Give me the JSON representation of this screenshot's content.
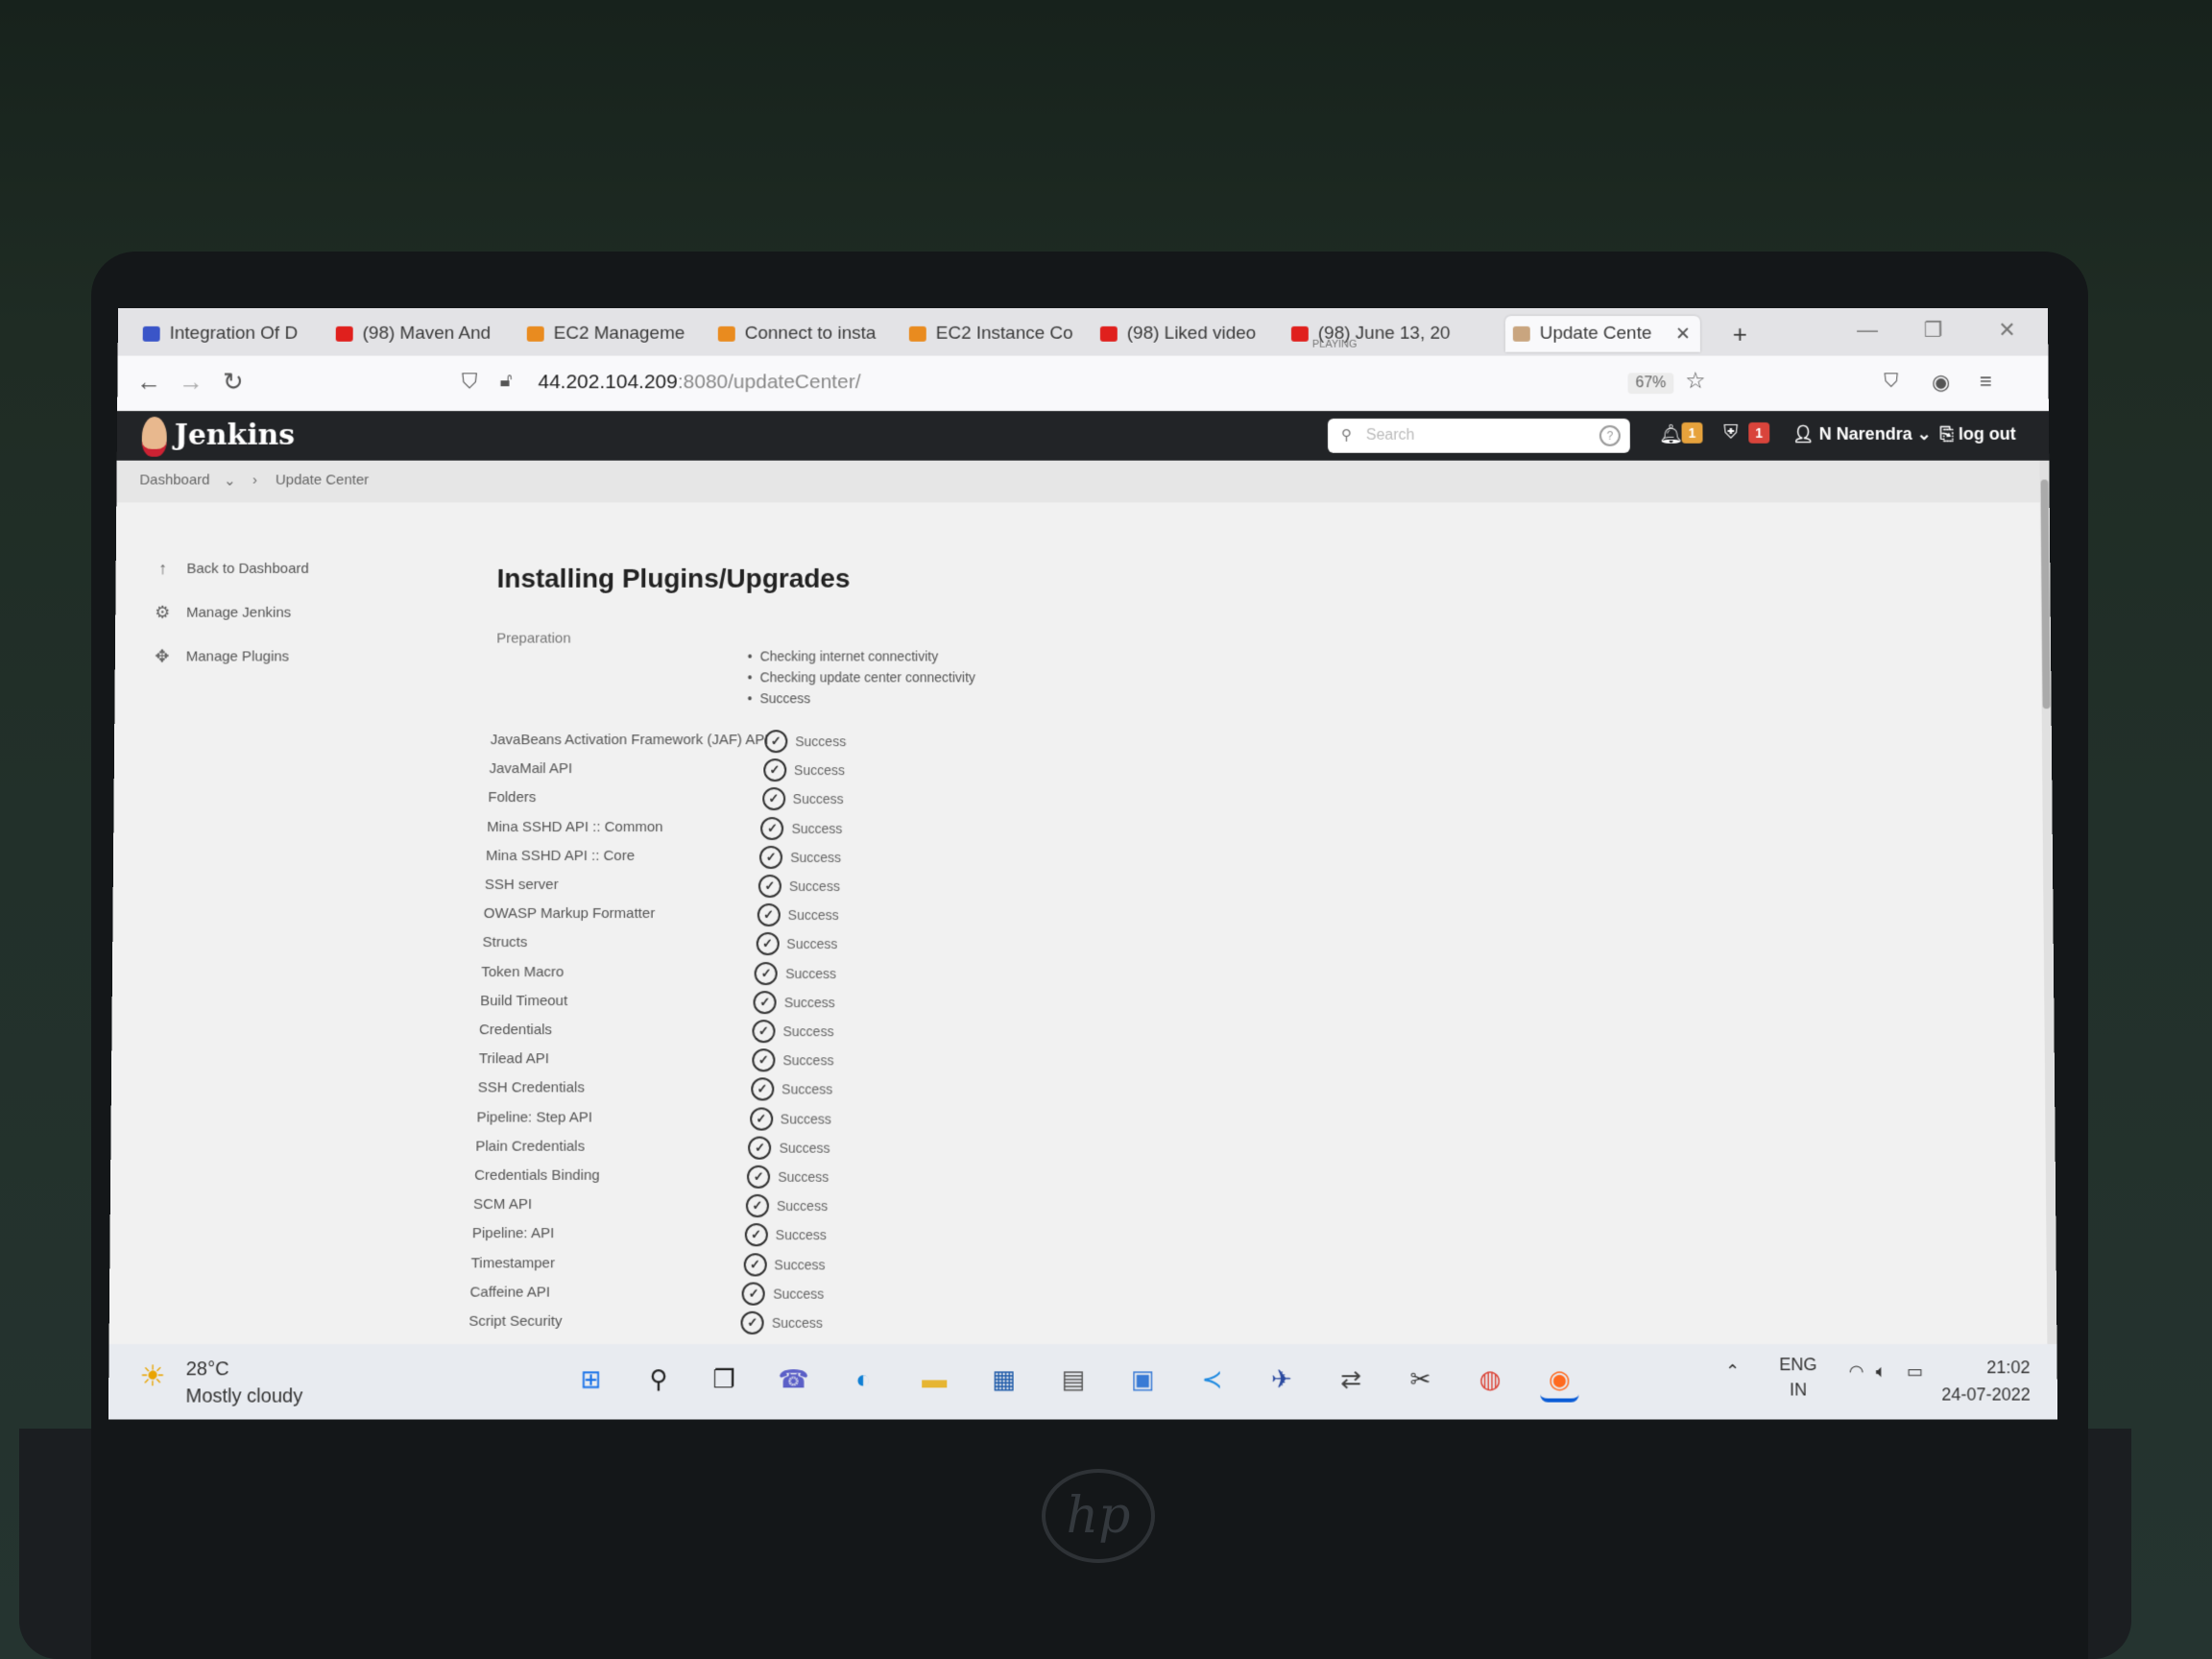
{
  "browser": {
    "tabs": [
      {
        "label": "Integration Of D",
        "icon": "codecademy-icon",
        "color": "#3a55c8"
      },
      {
        "label": "(98) Maven And",
        "icon": "youtube-icon",
        "color": "#e0201d"
      },
      {
        "label": "EC2 Manageme",
        "icon": "aws-icon",
        "color": "#e98b1f"
      },
      {
        "label": "Connect to insta",
        "icon": "aws-icon",
        "color": "#e98b1f"
      },
      {
        "label": "EC2 Instance Co",
        "icon": "aws-icon",
        "color": "#e98b1f"
      },
      {
        "label": "(98) Liked video",
        "icon": "youtube-icon",
        "color": "#e0201d"
      },
      {
        "label": "(98) June 13, 20",
        "sub": "PLAYING",
        "icon": "youtube-icon",
        "color": "#e0201d"
      },
      {
        "label": "Update Cente",
        "icon": "jenkins-icon",
        "color": "#c9a57f"
      }
    ],
    "url_host": "44.202.104.209",
    "url_rest": ":8080/updateCenter/",
    "zoom": "67%"
  },
  "jenkins": {
    "logo": "Jenkins",
    "search_placeholder": "Search",
    "notifications_count": "1",
    "security_count": "1",
    "user": "N Narendra",
    "logout": "log out",
    "breadcrumb": [
      "Dashboard",
      "Update Center"
    ],
    "side": [
      {
        "label": "Back to Dashboard",
        "icon": "arrow-up-icon"
      },
      {
        "label": "Manage Jenkins",
        "icon": "gear-icon"
      },
      {
        "label": "Manage Plugins",
        "icon": "puzzle-icon"
      }
    ],
    "title": "Installing Plugins/Upgrades",
    "preparation": {
      "label": "Preparation",
      "items": [
        "Checking internet connectivity",
        "Checking update center connectivity",
        "Success"
      ]
    },
    "plugins": [
      {
        "name": "JavaBeans Activation Framework (JAF) API",
        "status": "Success"
      },
      {
        "name": "JavaMail API",
        "status": "Success"
      },
      {
        "name": "Folders",
        "status": "Success"
      },
      {
        "name": "Mina SSHD API :: Common",
        "status": "Success"
      },
      {
        "name": "Mina SSHD API :: Core",
        "status": "Success"
      },
      {
        "name": "SSH server",
        "status": "Success"
      },
      {
        "name": "OWASP Markup Formatter",
        "status": "Success"
      },
      {
        "name": "Structs",
        "status": "Success"
      },
      {
        "name": "Token Macro",
        "status": "Success"
      },
      {
        "name": "Build Timeout",
        "status": "Success"
      },
      {
        "name": "Credentials",
        "status": "Success"
      },
      {
        "name": "Trilead API",
        "status": "Success"
      },
      {
        "name": "SSH Credentials",
        "status": "Success"
      },
      {
        "name": "Pipeline: Step API",
        "status": "Success"
      },
      {
        "name": "Plain Credentials",
        "status": "Success"
      },
      {
        "name": "Credentials Binding",
        "status": "Success"
      },
      {
        "name": "SCM API",
        "status": "Success"
      },
      {
        "name": "Pipeline: API",
        "status": "Success"
      },
      {
        "name": "Timestamper",
        "status": "Success"
      },
      {
        "name": "Caffeine API",
        "status": "Success"
      },
      {
        "name": "Script Security",
        "status": "Success"
      }
    ]
  },
  "taskbar": {
    "weather_temp": "28°C",
    "weather_desc": "Mostly cloudy",
    "lang_top": "ENG",
    "lang_bottom": "IN",
    "time": "21:02",
    "date": "24-07-2022"
  }
}
